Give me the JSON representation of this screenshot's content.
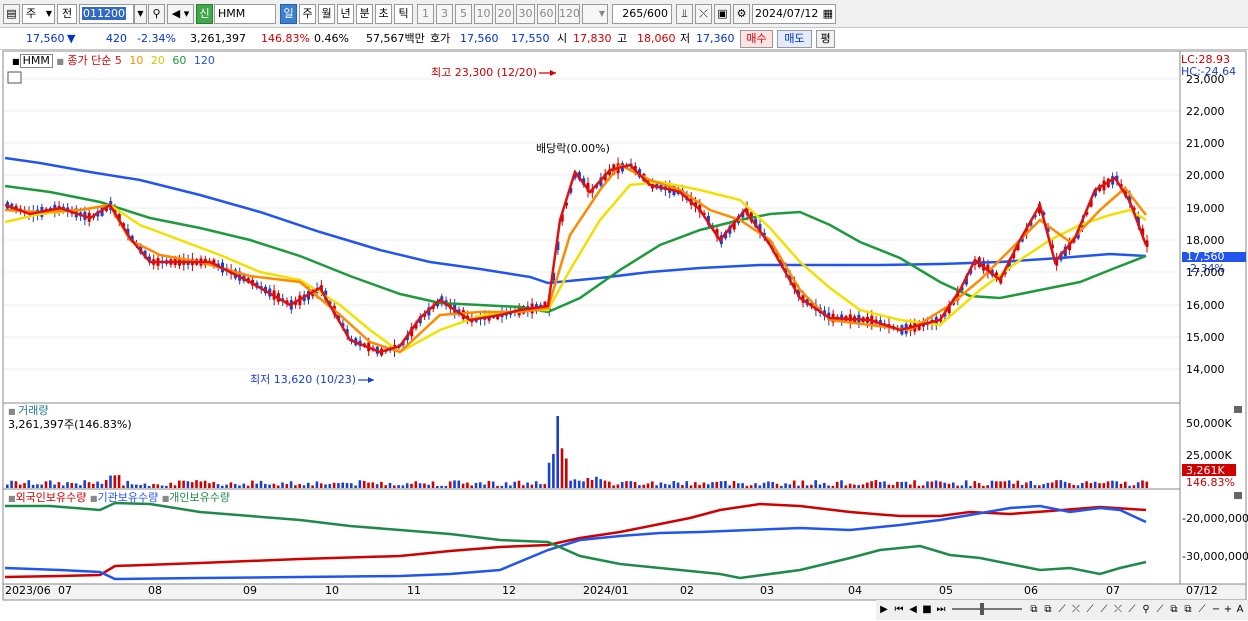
{
  "toolbar": {
    "type_label": "주",
    "market_label": "전",
    "code_value": "011200",
    "stock_name": "HMM",
    "badge_label": "신",
    "periods": [
      "일",
      "주",
      "월",
      "년",
      "분",
      "초",
      "틱"
    ],
    "interval_numbers": [
      "1",
      "3",
      "5",
      "10",
      "20",
      "30",
      "60",
      "120"
    ],
    "count_value": "265",
    "count_total": "/600",
    "date_value": "2024/07/12"
  },
  "quote": {
    "price": "17,560",
    "arrow": "▼",
    "change": "420",
    "change_pct": "-2.34%",
    "volume": "3,261,397",
    "volume_ratio": "146.83%",
    "turnover_pct": "0.46%",
    "amount": "57,567백만",
    "hoga_label": "호가",
    "ask": "17,560",
    "bid": "17,550",
    "open_label": "시",
    "open": "17,830",
    "high_label": "고",
    "high": "18,060",
    "low_label": "저",
    "low": "17,360",
    "buy_label": "매수",
    "sell_label": "매도",
    "eval_label": "평"
  },
  "main_legend": {
    "name": "HMM",
    "title": "종가 단순",
    "ma": [
      {
        "label": "5",
        "color": "#dd1111"
      },
      {
        "label": "10",
        "color": "#ff8a00"
      },
      {
        "label": "20",
        "color": "#e8d800"
      },
      {
        "label": "60",
        "color": "#1e9a3c"
      },
      {
        "label": "120",
        "color": "#2255ee"
      }
    ]
  },
  "annotations": {
    "high": "최고 23,300 (12/20)",
    "low": "최저 13,620 (10/23)",
    "dividend": "배당락(0.00%)",
    "lc": "LC:28.93",
    "hc": "HC:-24.64",
    "last_price": "17,560",
    "last_pct": "-2.34%"
  },
  "price_axis": [
    "23,000",
    "22,000",
    "21,000",
    "20,000",
    "19,000",
    "18,000",
    "17,000",
    "16,000",
    "15,000",
    "14,000"
  ],
  "volume_panel": {
    "title": "거래량",
    "value": "3,261,397주(146.83%)",
    "axis": [
      "50,000K",
      "25,000K"
    ],
    "last": "3,261K",
    "last_pct": "146.83%"
  },
  "holdings_panel": {
    "legend": [
      {
        "label": "외국인보유수량",
        "color": "#d00000"
      },
      {
        "label": "기관보유수량",
        "color": "#2255ee"
      },
      {
        "label": "개인보유수량",
        "color": "#1e8a4a"
      }
    ],
    "axis": [
      "-20,000,000",
      "-30,000,000"
    ]
  },
  "x_axis": [
    {
      "label": "2023/06"
    },
    {
      "label": "07"
    },
    {
      "label": "08"
    },
    {
      "label": "09"
    },
    {
      "label": "10"
    },
    {
      "label": "11"
    },
    {
      "label": "12"
    },
    {
      "label": "2024/01"
    },
    {
      "label": "02"
    },
    {
      "label": "03"
    },
    {
      "label": "04"
    },
    {
      "label": "05"
    },
    {
      "label": "06"
    },
    {
      "label": "07"
    },
    {
      "label": "07/12"
    }
  ],
  "colors": {
    "up": "#d00000",
    "down": "#1a3fcf",
    "panel_border": "#888888"
  }
}
